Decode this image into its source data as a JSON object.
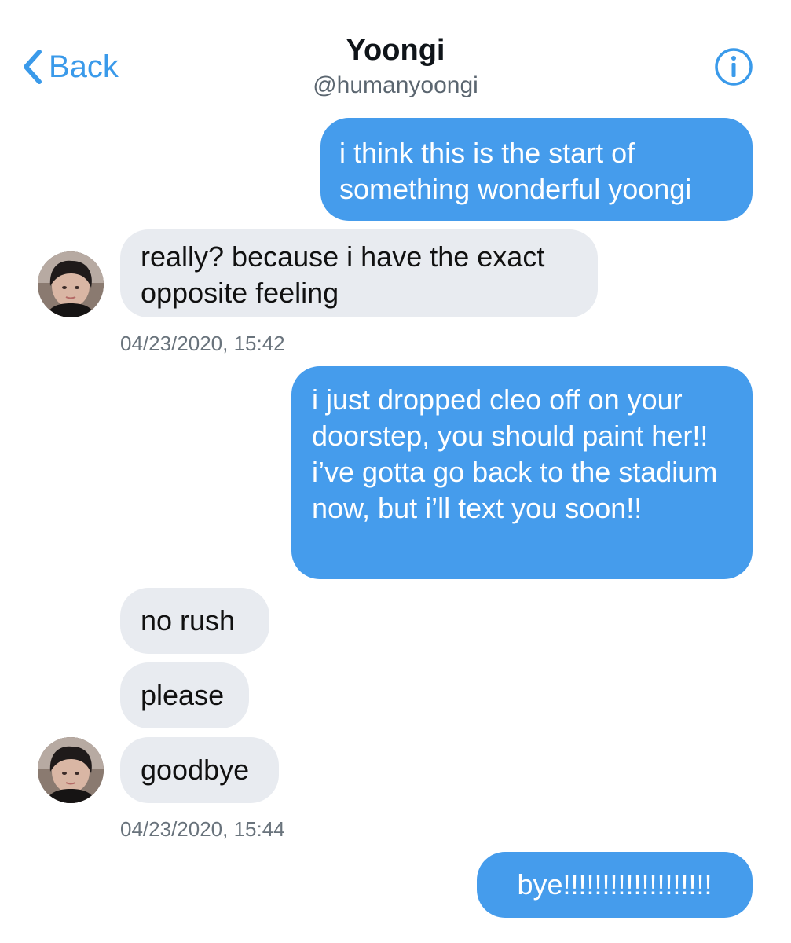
{
  "header": {
    "back_label": "Back",
    "title": "Yoongi",
    "handle": "@humanyoongi"
  },
  "icons": {
    "back": "chevron-left-icon",
    "info": "info-icon",
    "avatar": "profile-photo"
  },
  "colors": {
    "accent": "#3a9aea",
    "outgoing_bubble": "#459cec",
    "incoming_bubble": "#e8ebf0"
  },
  "messages": [
    {
      "direction": "outgoing",
      "text": "i think this is the start of something wonderful yoongi"
    },
    {
      "direction": "incoming",
      "text": "really? because i have the exact opposite feeling"
    },
    {
      "direction": "outgoing",
      "text": "i just dropped cleo off on your doorstep, you should paint her!! i’ve gotta go back to the stadium now, but i’ll text you soon!!"
    },
    {
      "direction": "incoming",
      "text": "no rush"
    },
    {
      "direction": "incoming",
      "text": "please"
    },
    {
      "direction": "incoming",
      "text": "goodbye"
    },
    {
      "direction": "outgoing",
      "text": "bye!!!!!!!!!!!!!!!!!!!"
    }
  ],
  "timestamps": [
    "04/23/2020, 15:42",
    "04/23/2020, 15:44"
  ]
}
